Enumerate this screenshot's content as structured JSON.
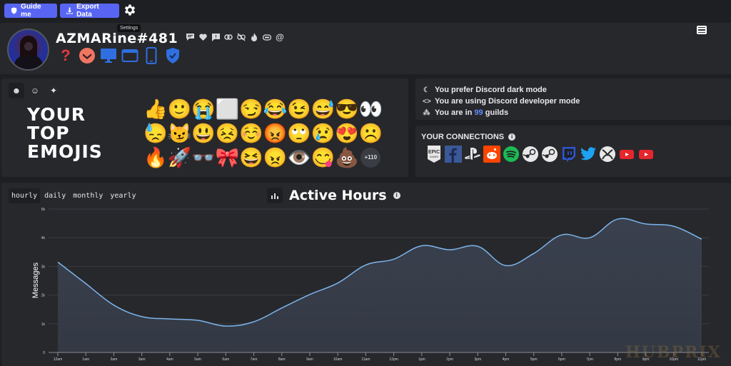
{
  "toolbar": {
    "guide_label": "Guide me",
    "export_label": "Export Data",
    "settings_tooltip": "Settings"
  },
  "profile": {
    "username": "AZMARine#481",
    "profile_icons": [
      "message-icon",
      "heart-icon",
      "report-icon",
      "link-icon",
      "unlink-icon",
      "fire-icon",
      "nitro-icon",
      "mention-icon"
    ],
    "badges": [
      "unknown-badge-icon",
      "hypesquad-icon",
      "desktop-icon",
      "browser-icon",
      "mobile-icon",
      "verified-shield-icon"
    ]
  },
  "emojis": {
    "tabs": [
      "emoji-icon",
      "custom-emoji-icon",
      "sparkles-icon"
    ],
    "title_lines": [
      "YOUR",
      "TOP",
      "EMOJIS"
    ],
    "items": [
      "👍",
      "🙂",
      "😭",
      "⬜",
      "😏",
      "😂",
      "😉",
      "😅",
      "😎",
      "👀",
      "😓",
      "😼",
      "😃",
      "😣",
      "☺️",
      "😡",
      "🙄",
      "😢",
      "😍",
      "☹️",
      "🔥",
      "🚀",
      "👓",
      "🎀",
      "😆",
      "😠",
      "👁️",
      "😋",
      "💩"
    ],
    "more_count": "+110"
  },
  "status": {
    "dark_mode": "You prefer Discord dark mode",
    "developer_mode": "You are using Discord developer mode",
    "guilds_prefix": "You are in",
    "guilds_count": "99",
    "guilds_suffix": "guilds"
  },
  "connections": {
    "title": "YOUR CONNECTIONS",
    "items": [
      "epic-games",
      "facebook",
      "playstation",
      "reddit",
      "spotify",
      "steam",
      "steam",
      "twitch",
      "twitter",
      "xbox",
      "youtube",
      "youtube"
    ]
  },
  "activity": {
    "range_tabs": [
      "hourly",
      "daily",
      "monthly",
      "yearly"
    ],
    "active_range": "hourly",
    "title": "Active Hours",
    "watermark": "HUBPRIX"
  },
  "colors": {
    "accent": "#5865f2",
    "line": "#7cb5ec",
    "highlight": "#5b8cff"
  },
  "chart_data": {
    "type": "area",
    "title": "Active Hours",
    "xlabel": "",
    "ylabel": "Messages",
    "categories": [
      "12am",
      "1am",
      "2am",
      "3am",
      "4am",
      "5am",
      "6am",
      "7am",
      "8am",
      "9am",
      "10am",
      "11am",
      "12pm",
      "1pm",
      "2pm",
      "3pm",
      "4pm",
      "5pm",
      "6pm",
      "7pm",
      "8pm",
      "9pm",
      "10pm",
      "11pm"
    ],
    "values": [
      3150,
      2400,
      1650,
      1250,
      1170,
      1120,
      920,
      1070,
      1550,
      2020,
      2420,
      3050,
      3250,
      3720,
      3580,
      3700,
      3030,
      3450,
      4100,
      4000,
      4650,
      4480,
      4400,
      3950
    ],
    "ylim": [
      0,
      5000
    ],
    "yticks": [
      "0",
      "1k",
      "2k",
      "3k",
      "4k",
      "5k"
    ],
    "ytick_values": [
      0,
      1000,
      2000,
      3000,
      4000,
      5000
    ],
    "grid": true,
    "legend": "none"
  }
}
